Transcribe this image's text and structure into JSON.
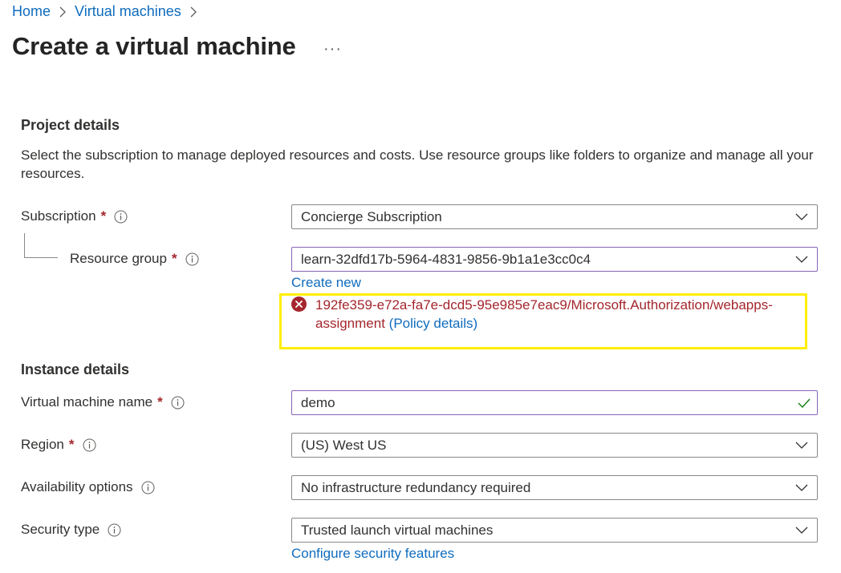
{
  "breadcrumb": {
    "items": [
      "Home",
      "Virtual machines"
    ]
  },
  "page": {
    "title": "Create a virtual machine",
    "more_label": "···"
  },
  "project": {
    "title": "Project details",
    "description": "Select the subscription to manage deployed resources and costs. Use resource groups like folders to organize and manage all your resources.",
    "subscription": {
      "label": "Subscription",
      "value": "Concierge Subscription"
    },
    "resource_group": {
      "label": "Resource group",
      "value": "learn-32dfd17b-5964-4831-9856-9b1a1e3cc0c4",
      "create_new": "Create new"
    },
    "error": {
      "message": "192fe359-e72a-fa7e-dcd5-95e985e7eac9/Microsoft.Authorization/webapps-assignment",
      "link": "(Policy details)"
    }
  },
  "instance": {
    "title": "Instance details",
    "vm_name": {
      "label": "Virtual machine name",
      "value": "demo"
    },
    "region": {
      "label": "Region",
      "value": "(US) West US"
    },
    "availability": {
      "label": "Availability options",
      "value": "No infrastructure redundancy required"
    },
    "security": {
      "label": "Security type",
      "value": "Trusted launch virtual machines",
      "configure_link": "Configure security features"
    }
  },
  "required_marker": "*",
  "colors": {
    "link": "#0f6cbd",
    "error": "#a4262c",
    "highlight": "#ffee00",
    "valid": "#107c10",
    "focused_border": "#8764b8"
  }
}
